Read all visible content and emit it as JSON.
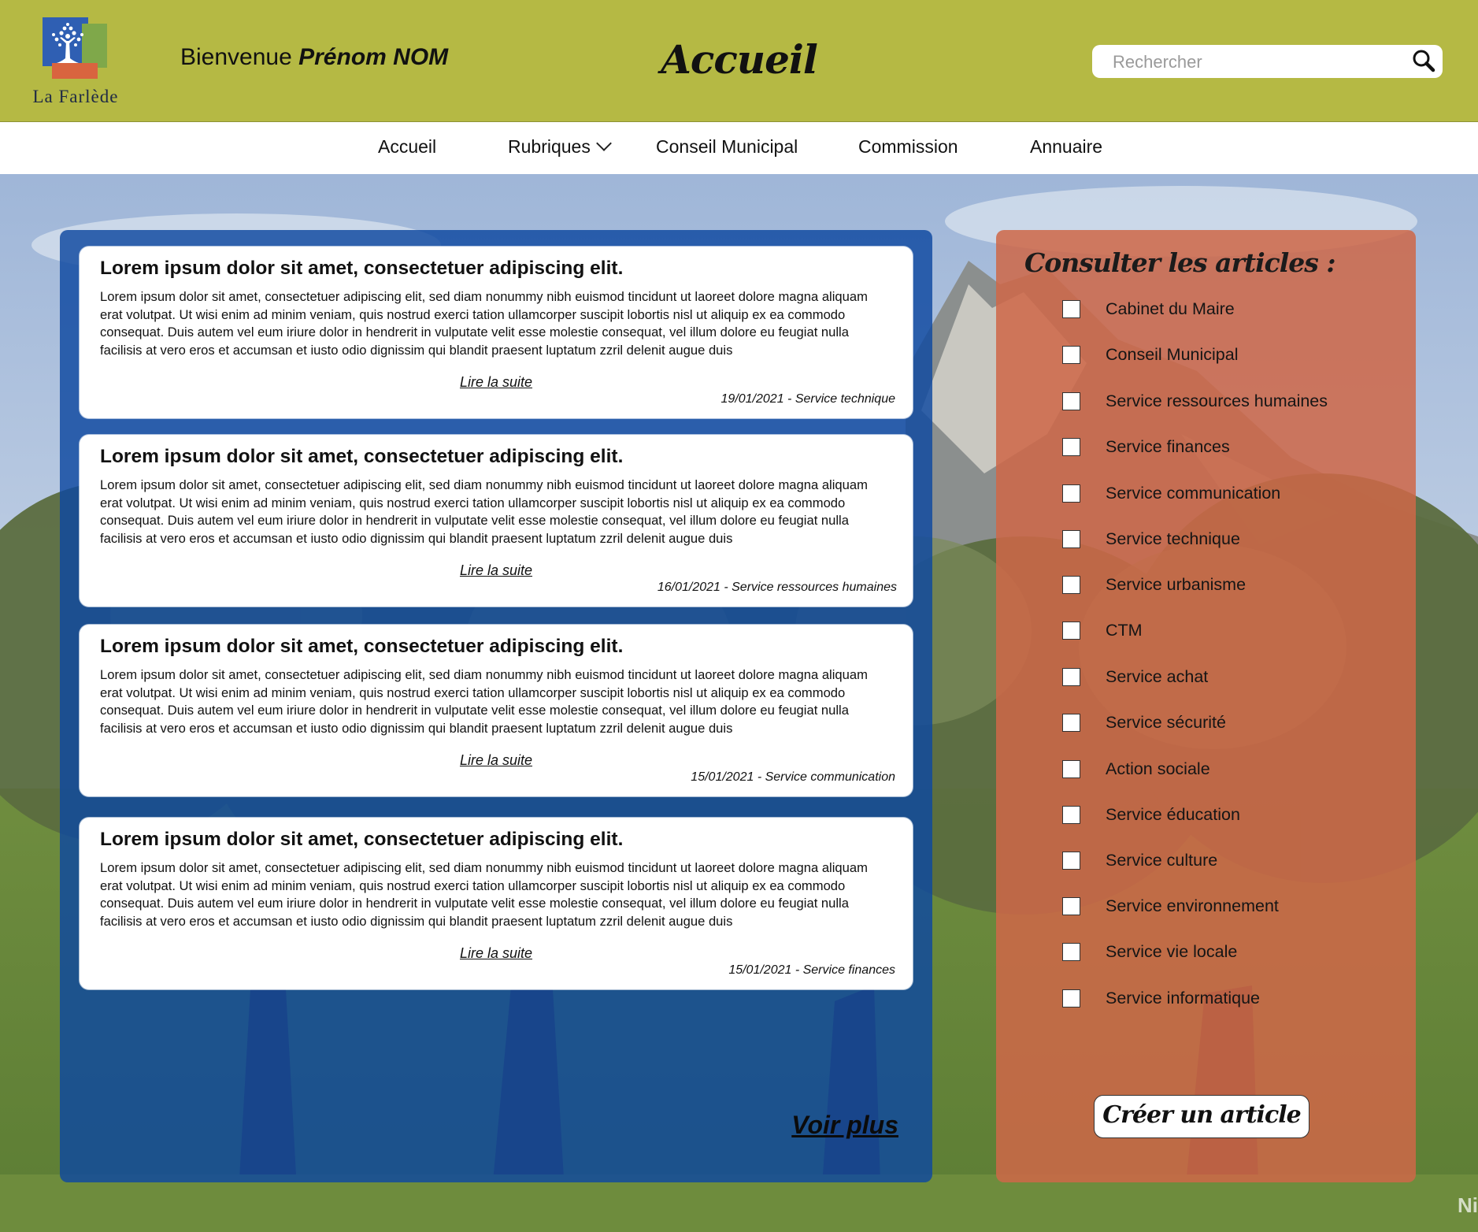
{
  "header": {
    "logo_text": "La Farlède",
    "welcome_prefix": "Bienvenue ",
    "welcome_name": "Prénom NOM",
    "title": "Accueil",
    "search_placeholder": "Rechercher"
  },
  "nav": {
    "items": [
      {
        "label": "Accueil"
      },
      {
        "label": "Rubriques"
      },
      {
        "label": "Conseil Municipal"
      },
      {
        "label": "Commission"
      },
      {
        "label": "Annuaire"
      }
    ]
  },
  "articles": {
    "items": [
      {
        "title": "Lorem ipsum dolor sit amet, consectetuer adipiscing elit.",
        "body": "Lorem ipsum dolor sit amet, consectetuer adipiscing elit, sed diam nonummy nibh euismod tincidunt ut laoreet dolore magna aliquam erat volutpat. Ut wisi enim ad minim veniam, quis nostrud exerci tation ullamcorper suscipit lobortis nisl ut aliquip ex ea commodo consequat. Duis autem vel eum iriure dolor in hendrerit in vulputate velit esse molestie consequat, vel illum dolore eu feugiat nulla facilisis at vero eros et accumsan et iusto odio dignissim qui blandit praesent luptatum zzril delenit augue duis",
        "read_more": "Lire la suite",
        "meta": "19/01/2021 - Service technique"
      },
      {
        "title": "Lorem ipsum dolor sit amet, consectetuer adipiscing elit.",
        "body": "Lorem ipsum dolor sit amet, consectetuer adipiscing elit, sed diam nonummy nibh euismod tincidunt ut laoreet dolore magna aliquam erat volutpat. Ut wisi enim ad minim veniam, quis nostrud exerci tation ullamcorper suscipit lobortis nisl ut aliquip ex ea commodo consequat. Duis autem vel eum iriure dolor in hendrerit in vulputate velit esse molestie consequat, vel illum dolore eu feugiat nulla facilisis at vero eros et accumsan et iusto odio dignissim qui blandit praesent luptatum zzril delenit augue duis",
        "read_more": "Lire la suite",
        "meta": "16/01/2021 - Service ressources humaines"
      },
      {
        "title": "Lorem ipsum dolor sit amet, consectetuer adipiscing elit.",
        "body": "Lorem ipsum dolor sit amet, consectetuer adipiscing elit, sed diam nonummy nibh euismod tincidunt ut laoreet dolore magna aliquam erat volutpat. Ut wisi enim ad minim veniam, quis nostrud exerci tation ullamcorper suscipit lobortis nisl ut aliquip ex ea commodo consequat. Duis autem vel eum iriure dolor in hendrerit in vulputate velit esse molestie consequat, vel illum dolore eu feugiat nulla facilisis at vero eros et accumsan et iusto odio dignissim qui blandit praesent luptatum zzril delenit augue duis",
        "read_more": "Lire la suite",
        "meta": "15/01/2021 - Service communication"
      },
      {
        "title": "Lorem ipsum dolor sit amet, consectetuer adipiscing elit.",
        "body": "Lorem ipsum dolor sit amet, consectetuer adipiscing elit, sed diam nonummy nibh euismod tincidunt ut laoreet dolore magna aliquam erat volutpat. Ut wisi enim ad minim veniam, quis nostrud exerci tation ullamcorper suscipit lobortis nisl ut aliquip ex ea commodo consequat. Duis autem vel eum iriure dolor in hendrerit in vulputate velit esse molestie consequat, vel illum dolore eu feugiat nulla facilisis at vero eros et accumsan et iusto odio dignissim qui blandit praesent luptatum zzril delenit augue duis",
        "read_more": "Lire la suite",
        "meta": "15/01/2021 - Service finances"
      }
    ],
    "voir_plus": "Voir plus"
  },
  "filters": {
    "title": "Consulter les articles :",
    "items": [
      {
        "label": "Cabinet du Maire",
        "checked": false
      },
      {
        "label": "Conseil Municipal",
        "checked": false
      },
      {
        "label": "Service ressources humaines",
        "checked": false
      },
      {
        "label": "Service finances",
        "checked": false
      },
      {
        "label": "Service communication",
        "checked": false
      },
      {
        "label": "Service technique",
        "checked": false
      },
      {
        "label": "Service urbanisme",
        "checked": false
      },
      {
        "label": "CTM",
        "checked": false
      },
      {
        "label": "Service achat",
        "checked": false
      },
      {
        "label": "Service sécurité",
        "checked": false
      },
      {
        "label": "Action sociale",
        "checked": false
      },
      {
        "label": "Service éducation",
        "checked": false
      },
      {
        "label": "Service culture",
        "checked": false
      },
      {
        "label": "Service environnement",
        "checked": false
      },
      {
        "label": "Service vie locale",
        "checked": false
      },
      {
        "label": "Service informatique",
        "checked": false
      }
    ],
    "create_label": "Créer un article"
  },
  "watermark": "Ni",
  "colors": {
    "header_bg": "#b5b944",
    "articles_panel": "#0e48a0",
    "filters_panel": "#ce6848"
  }
}
